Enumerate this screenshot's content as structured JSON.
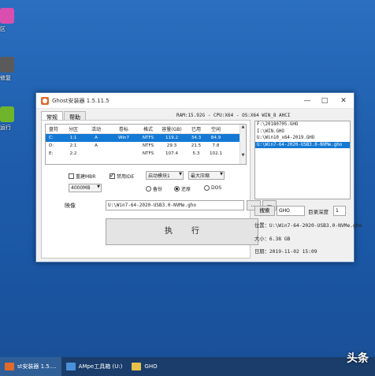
{
  "desktop": {
    "icons": [
      {
        "label": "区",
        "icon": "pink-app-icon",
        "color": "#d84fb0"
      },
      {
        "label": "修复",
        "icon": "tool-app-icon",
        "color": "#5a5a5a"
      },
      {
        "label": "运行",
        "icon": "green-app-icon",
        "color": "#6fb52c"
      }
    ]
  },
  "window": {
    "title": "Ghost安装器 1.5.11.5",
    "tabs": [
      "常规",
      "帮助"
    ],
    "info_line": "RAM:15.92G - CPU:X64 - OS:X64 WIN_8 AHCI",
    "table": {
      "headers": [
        "盘符",
        "分区",
        "活动",
        "卷标",
        "格式",
        "容量(GB)",
        "已用",
        "空闲"
      ],
      "rows": [
        [
          "C:",
          "1:1",
          "A",
          "Win7",
          "NTFS",
          "119.2",
          "34.3",
          "84.9"
        ],
        [
          "D:",
          "2:1",
          "A",
          "",
          "NTFS",
          "29.3",
          "21.5",
          "7.8"
        ],
        [
          "E:",
          "2:2",
          "",
          "",
          "NTFS",
          "107.4",
          "5.3",
          "102.1"
        ]
      ],
      "selected_row": 0
    },
    "options": {
      "reboot_label": "重建MBR",
      "disable_ide_label": "禁用IDE",
      "boot_module": "启动模块1",
      "compression": "最大压缩",
      "size_select": "4000MB",
      "backup_label": "备份",
      "restore_label": "还原",
      "dos_label": "DOS"
    },
    "image_label": "映像",
    "image_path": "U:\\Win7-64-2020-USB3.0-NVMe.gho",
    "dots_label": "...",
    "arrow_label": "—",
    "execute_label": "执行",
    "file_list": [
      "F:\\20180705.GHO",
      "I:\\WIN.GHO",
      "U:\\Win10_x64-2019.GHO",
      "U:\\Win7-64-2020-USB3.0-NVMe.gho"
    ],
    "file_selected": 3,
    "search_label": "搜索",
    "ext_value": "GHO",
    "depth_label": "目录深度",
    "depth_value": "1",
    "location_label": "位置：",
    "location_value": "U:\\Win7-64-2020-USB3.0-NVMe.gho",
    "size_label": "大小：",
    "size_value": "6.38 GB",
    "date_label": "日期：",
    "date_value": "2019-11-02  15:09"
  },
  "taskbar": {
    "items": [
      {
        "label": "st安装器 1.5....",
        "icon": "ghost-icon",
        "active": true
      },
      {
        "label": "AMpe工具箱 (U:)",
        "icon": "toolbox-icon",
        "active": false
      },
      {
        "label": "GHO",
        "icon": "folder-icon",
        "active": false
      }
    ]
  },
  "watermark": "头条"
}
